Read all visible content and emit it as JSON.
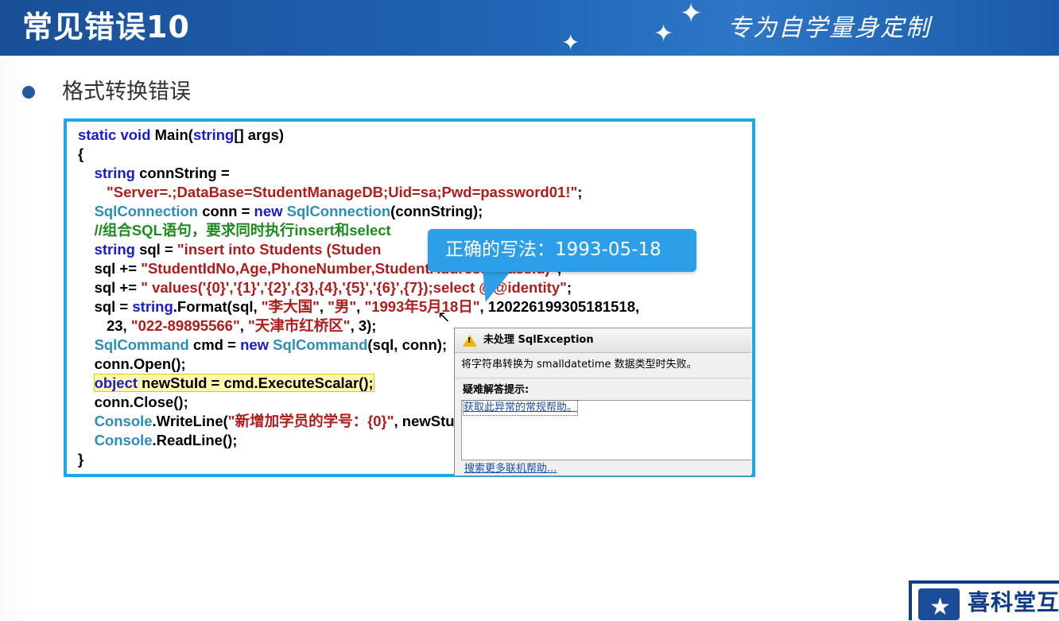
{
  "header": {
    "title": "常见错误10",
    "tagline": "专为自学量身定制"
  },
  "bullet": {
    "text": "格式转换错误"
  },
  "code": {
    "l1_kw": "static void",
    "l1_rest": " Main(",
    "l1_kw2": "string",
    "l1_end": "[] args)",
    "l2": "{",
    "l3_kw": "string",
    "l3_rest": " connString =",
    "l4_str": "\"Server=.;DataBase=StudentManageDB;Uid=sa;Pwd=password01!\"",
    "l4_end": ";",
    "l5_ty": "SqlConnection",
    "l5_mid": " conn = ",
    "l5_kw": "new",
    "l5_ty2": " SqlConnection",
    "l5_end": "(connString);",
    "l6_cm": "//组合SQL语句，要求同时执行insert和select",
    "l7_kw": "string",
    "l7_mid": " sql = ",
    "l7_str": "\"insert into Students (Studen",
    "l8_start": "sql += ",
    "l8_str": "\"StudentIdNo,Age,PhoneNumber,StudentAddress,ClassId)\"",
    "l8_end": ";",
    "l9_start": "sql += ",
    "l9_str": "\" values('{0}','{1}','{2}',{3},{4},'{5}','{6}',{7});select @@identity\"",
    "l9_end": ";",
    "l10_start": "sql = ",
    "l10_kw": "string",
    "l10_mid": ".Format(sql, ",
    "l10_s1": "\"李大国\"",
    "l10_c1": ", ",
    "l10_s2": "\"男\"",
    "l10_c2": ", ",
    "l10_s3": "\"1993年5月18日\"",
    "l10_end": ", 120226199305181518,",
    "l11_start": "23, ",
    "l11_s1": "\"022-89895566\"",
    "l11_c1": ", ",
    "l11_s2": "\"天津市红桥区\"",
    "l11_end": ", 3);",
    "l12_ty": "SqlCommand",
    "l12_mid": " cmd = ",
    "l12_kw": "new",
    "l12_ty2": " SqlCommand",
    "l12_end": "(sql, conn);",
    "l13": "conn.Open();",
    "l14_kw": "object",
    "l14_end": " newStuId = cmd.ExecuteScalar();",
    "l15": "conn.Close();",
    "l16_ty": "Console",
    "l16_mid": ".WriteLine(",
    "l16_str": "\"新增加学员的学号：{0}\"",
    "l16_end": ", newStuId);",
    "l17_ty": "Console",
    "l17_end": ".ReadLine();",
    "l18": "}"
  },
  "callout": {
    "text": "正确的写法：1993-05-18"
  },
  "exception": {
    "title": "未处理 SqlException",
    "message": "将字符串转换为 smalldatetime 数据类型时失败。",
    "tips_label": "疑难解答提示:",
    "tip_link": "获取此异常的常规帮助。",
    "more_link": "搜索更多联机帮助..."
  },
  "logo": {
    "text": "喜科堂互"
  },
  "colors": {
    "header_blue": "#1f63b3",
    "code_border": "#1ba9e6",
    "keyword": "#1a1ad4",
    "type": "#2a8fb8",
    "string": "#b01c1c",
    "comment": "#1f8a1f",
    "callout": "#2d9fe8"
  }
}
